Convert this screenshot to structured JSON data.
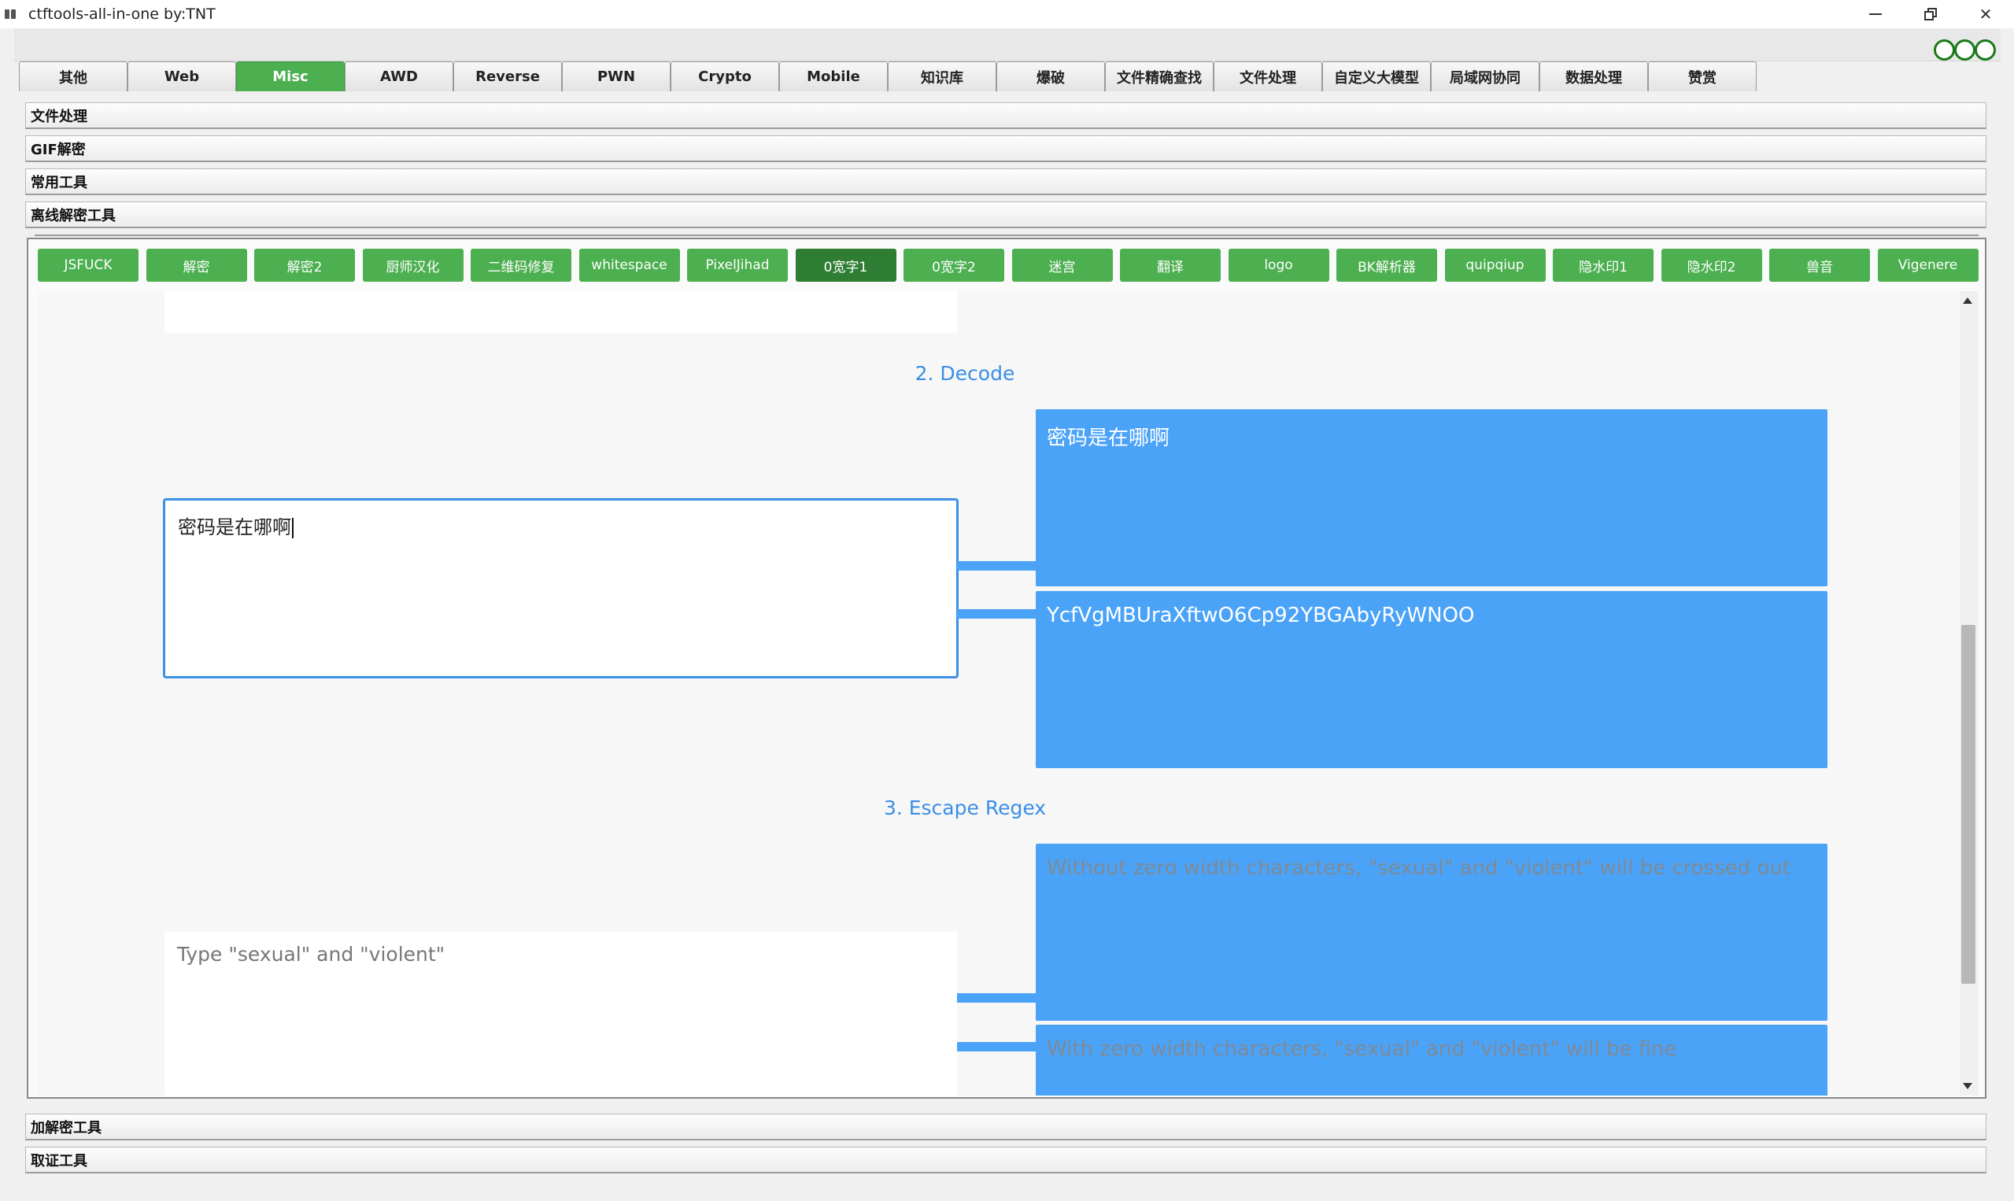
{
  "window": {
    "title": "ctftools-all-in-one   by:TNT"
  },
  "tabs": [
    {
      "label": "其他",
      "active": false
    },
    {
      "label": "Web",
      "active": false
    },
    {
      "label": "Misc",
      "active": true
    },
    {
      "label": "AWD",
      "active": false
    },
    {
      "label": "Reverse",
      "active": false
    },
    {
      "label": "PWN",
      "active": false
    },
    {
      "label": "Crypto",
      "active": false
    },
    {
      "label": "Mobile",
      "active": false
    },
    {
      "label": "知识库",
      "active": false
    },
    {
      "label": "爆破",
      "active": false
    },
    {
      "label": "文件精确查找",
      "active": false
    },
    {
      "label": "文件处理",
      "active": false
    },
    {
      "label": "自定义大模型",
      "active": false
    },
    {
      "label": "局域网协同",
      "active": false
    },
    {
      "label": "数据处理",
      "active": false
    },
    {
      "label": "赞赏",
      "active": false
    }
  ],
  "sections": {
    "file_processing": "文件处理",
    "gif_decrypt": "GIF解密",
    "common_tools": "常用工具",
    "offline_decrypt": "离线解密工具",
    "crypto_tools": "加解密工具",
    "forensics_tools": "取证工具"
  },
  "toolbar": [
    {
      "label": "JSFUCK"
    },
    {
      "label": "解密"
    },
    {
      "label": "解密2"
    },
    {
      "label": "厨师汉化"
    },
    {
      "label": "二维码修复"
    },
    {
      "label": "whitespace"
    },
    {
      "label": "PixelJihad"
    },
    {
      "label": "0宽字1"
    },
    {
      "label": "0宽字2"
    },
    {
      "label": "迷宫"
    },
    {
      "label": "翻译"
    },
    {
      "label": "logo"
    },
    {
      "label": "BK解析器"
    },
    {
      "label": "quipqiup"
    },
    {
      "label": "隐水印1"
    },
    {
      "label": "隐水印2"
    },
    {
      "label": "兽音"
    },
    {
      "label": "Vigenere"
    }
  ],
  "content": {
    "decode": {
      "heading": "2. Decode",
      "input_value": "密码是在哪啊",
      "output_plain": "密码是在哪啊",
      "output_hidden": "YcfVgMBUraXftwO6Cp92YBGAbyRyWNOO"
    },
    "escape": {
      "heading": "3. Escape Regex",
      "input_placeholder": "Type \"sexual\" and \"violent\"",
      "output_without": "Without zero width characters, \"sexual\" and \"violent\" will be crossed out",
      "output_with": "With zero width characters, \"sexual\" and \"violent\" will be fine"
    }
  },
  "colors": {
    "accent_green": "#4caf50",
    "dark_green": "#2e7d32",
    "accent_blue": "#4ba3f8",
    "heading_blue": "#3a8ee6"
  }
}
